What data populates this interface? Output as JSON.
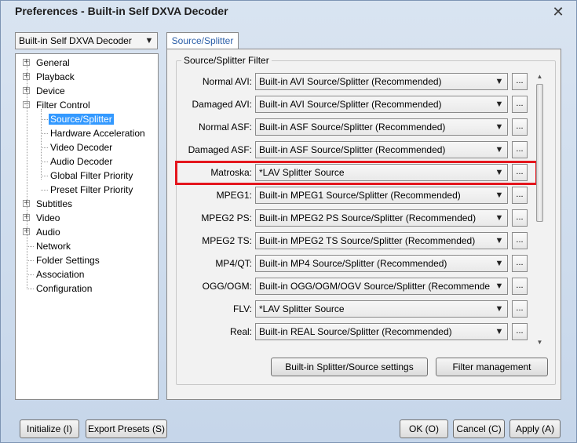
{
  "window": {
    "title": "Preferences - Built-in Self DXVA Decoder",
    "close_glyph": "✕"
  },
  "decoder_select": {
    "value": "Built-in Self DXVA Decoder"
  },
  "tree": {
    "items": [
      {
        "label": "General",
        "expander": "+"
      },
      {
        "label": "Playback",
        "expander": "+"
      },
      {
        "label": "Device",
        "expander": "+"
      },
      {
        "label": "Filter Control",
        "expander": "−"
      },
      {
        "label": "Source/Splitter",
        "selected": true
      },
      {
        "label": "Hardware Acceleration"
      },
      {
        "label": "Video Decoder"
      },
      {
        "label": "Audio Decoder"
      },
      {
        "label": "Global Filter Priority"
      },
      {
        "label": "Preset Filter Priority"
      },
      {
        "label": "Subtitles",
        "expander": "+"
      },
      {
        "label": "Video",
        "expander": "+"
      },
      {
        "label": "Audio",
        "expander": "+"
      },
      {
        "label": "Network"
      },
      {
        "label": "Folder Settings"
      },
      {
        "label": "Association"
      },
      {
        "label": "Configuration"
      }
    ]
  },
  "tab": {
    "label": "Source/Splitter"
  },
  "group": {
    "title": "Source/Splitter Filter"
  },
  "rows": [
    {
      "label": "Normal AVI:",
      "value": "Built-in AVI Source/Splitter (Recommended)"
    },
    {
      "label": "Damaged AVI:",
      "value": "Built-in AVI Source/Splitter (Recommended)"
    },
    {
      "label": "Normal ASF:",
      "value": "Built-in ASF Source/Splitter (Recommended)"
    },
    {
      "label": "Damaged ASF:",
      "value": "Built-in ASF Source/Splitter (Recommended)"
    },
    {
      "label": "Matroska:",
      "value": "*LAV Splitter Source"
    },
    {
      "label": "MPEG1:",
      "value": "Built-in MPEG1 Source/Splitter (Recommended)"
    },
    {
      "label": "MPEG2 PS:",
      "value": "Built-in MPEG2 PS Source/Splitter (Recommended)"
    },
    {
      "label": "MPEG2 TS:",
      "value": "Built-in MPEG2 TS Source/Splitter (Recommended)"
    },
    {
      "label": "MP4/QT:",
      "value": "Built-in MP4 Source/Splitter (Recommended)"
    },
    {
      "label": "OGG/OGM:",
      "value": "Built-in OGG/OGM/OGV Source/Splitter (Recommended"
    },
    {
      "label": "FLV:",
      "value": "*LAV Splitter Source"
    },
    {
      "label": "Real:",
      "value": "Built-in REAL Source/Splitter (Recommended)"
    }
  ],
  "dots_label": "...",
  "combo_arrow": "▼",
  "buttons": {
    "splitter_settings": "Built-in Splitter/Source settings",
    "filter_management": "Filter management",
    "initialize": "Initialize (I)",
    "export_presets": "Export Presets (S)",
    "ok": "OK (O)",
    "cancel": "Cancel (C)",
    "apply": "Apply (A)"
  },
  "colors": {
    "highlight": "#e4161d",
    "selection": "#3399ff",
    "tab_text": "#2a5ea8"
  }
}
